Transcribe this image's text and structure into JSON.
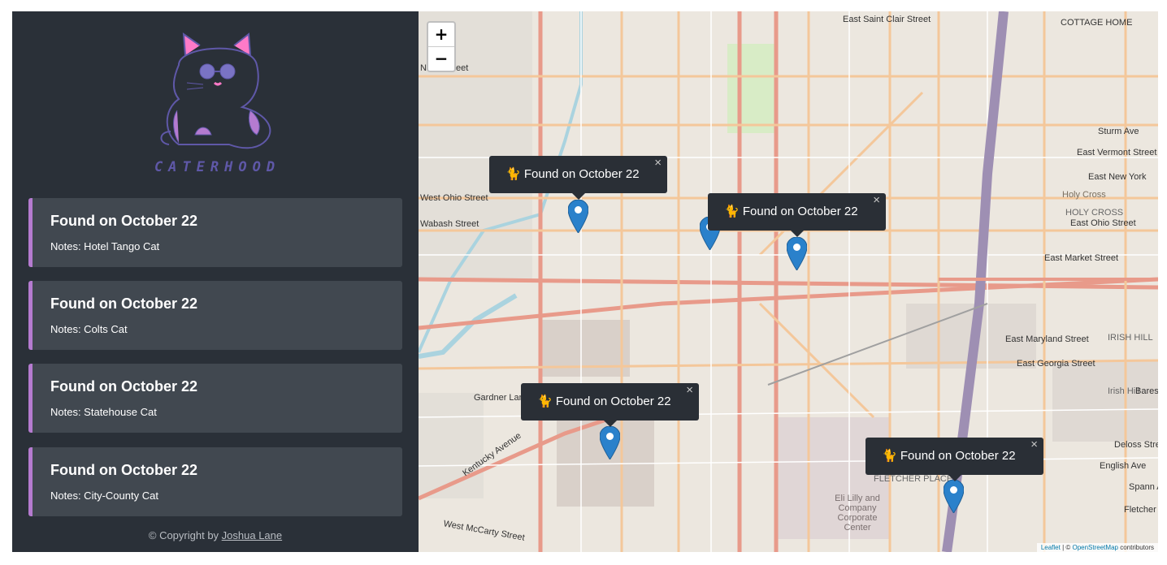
{
  "brand": {
    "name": "CATERHOOD"
  },
  "cats": [
    {
      "title": "Found on October 22",
      "notes": "Notes: Hotel Tango Cat"
    },
    {
      "title": "Found on October 22",
      "notes": "Notes: Colts Cat"
    },
    {
      "title": "Found on October 22",
      "notes": "Notes: Statehouse Cat"
    },
    {
      "title": "Found on October 22",
      "notes": "Notes: City-County Cat"
    }
  ],
  "footer": {
    "prefix": "© Copyright by",
    "author": "Joshua Lane"
  },
  "map": {
    "zoom_in": "+",
    "zoom_out": "−",
    "popups": [
      {
        "label": "🐈 Found on October 22",
        "close": "×"
      },
      {
        "label": "🐈 Found on October 22",
        "close": "×"
      },
      {
        "label": "🐈 Found on October 22",
        "close": "×"
      },
      {
        "label": "🐈 Found on October 22",
        "close": "×"
      }
    ],
    "attribution": {
      "leaflet": "Leaflet",
      "sep": " | © ",
      "osm": "OpenStreetMap",
      "suffix": " contributors"
    },
    "labels": {
      "east_saint_clair": "East Saint Clair Street",
      "cottage_home": "COTTAGE HOME",
      "north_street": "North Street",
      "west_ohio": "West Ohio Street",
      "wabash": "Wabash Street",
      "east_vermont": "East Vermont Street",
      "east_new_york": "East New York",
      "holy_cross_1": "Holy Cross",
      "holy_cross_2": "HOLY CROSS",
      "east_ohio": "East Ohio Street",
      "east_market": "East Market Street",
      "sturm": "Sturm Ave",
      "east_maryland": "East Maryland Street",
      "irish_hill_caps": "IRISH HILL",
      "east_georgia": "East Georgia Street",
      "irish_hill": "Irish Hill",
      "bares": "Bares",
      "gardner": "Gardner Lane",
      "kentucky": "Kentucky Avenue",
      "fletcher_place": "FLETCHER PLACE",
      "eli_lilly": "Eli Lilly and Company Corporate Center",
      "deloss": "Deloss Stre",
      "english": "English Ave",
      "spann": "Spann A",
      "fletcher": "Fletcher A",
      "mccarty": "West McCarty Street"
    }
  }
}
